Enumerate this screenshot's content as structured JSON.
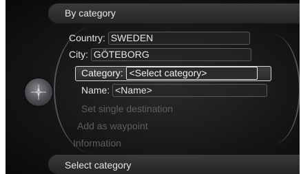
{
  "header": {
    "title": "By category"
  },
  "footer": {
    "title": "Select category"
  },
  "knob": {
    "icon": "compass-icon"
  },
  "form": {
    "country_label": "Country:",
    "country_value": "SWEDEN",
    "city_label": "City:",
    "city_value": "GÖTEBORG",
    "category_label": "Category:",
    "category_value": "<Select category>",
    "name_label": "Name:",
    "name_value": "<Name>"
  },
  "menu": {
    "set_destination": "Set single destination",
    "add_waypoint": "Add as waypoint",
    "information": "Information"
  }
}
